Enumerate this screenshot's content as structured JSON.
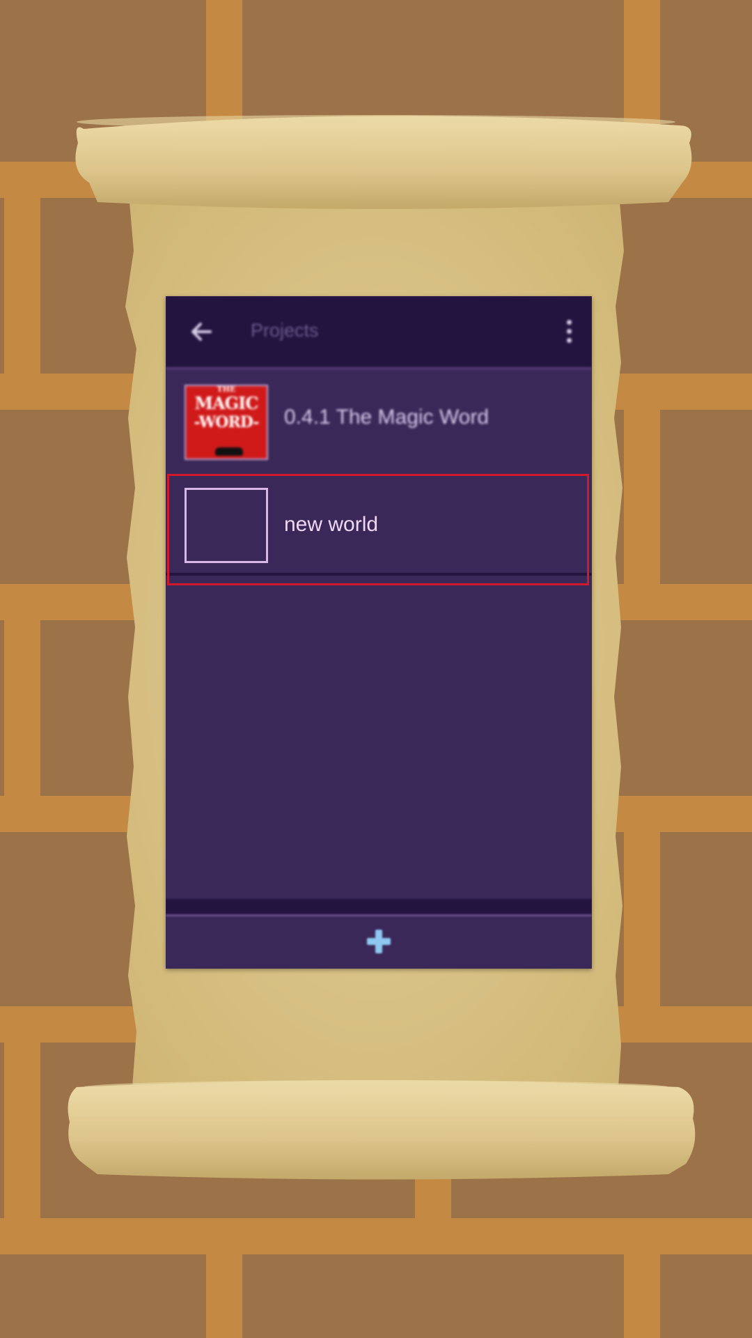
{
  "toolbar": {
    "title": "Projects",
    "back_icon": "arrow-left-icon",
    "menu_icon": "overflow-menu-icon"
  },
  "projects": [
    {
      "name": "0.4.1 The Magic Word",
      "thumbnail": {
        "line1": "THE",
        "line2": "MAGIC",
        "line3": "-WORD-"
      }
    },
    {
      "name": "new world",
      "thumbnail": null
    }
  ],
  "fab": {
    "icon": "plus-icon"
  },
  "colors": {
    "toolbar_bg": "#22133f",
    "list_bg": "#3a2858",
    "highlight": "#d0192a",
    "plus": "#8ec8f0"
  }
}
